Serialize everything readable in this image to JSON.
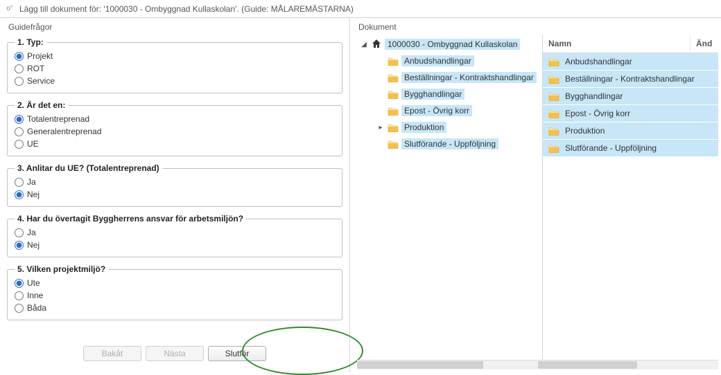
{
  "window": {
    "title": "Lägg till dokument för: '1000030 - Ombyggnad Kullaskolan'.  (Guide: MÅLAREMÄSTARNA)"
  },
  "left": {
    "heading": "Guidefrågor",
    "questions": [
      {
        "legend": "1. Typ:",
        "name": "q1",
        "selected": 0,
        "options": [
          "Projekt",
          "ROT",
          "Service"
        ]
      },
      {
        "legend": "2. Är det en:",
        "name": "q2",
        "selected": 0,
        "options": [
          "Totalentreprenad",
          "Generalentreprenad",
          "UE"
        ]
      },
      {
        "legend": "3. Anlitar du UE? (Totalentreprenad)",
        "name": "q3",
        "selected": 1,
        "options": [
          "Ja",
          "Nej"
        ]
      },
      {
        "legend": "4. Har du övertagit Byggherrens ansvar för arbetsmiljön?",
        "name": "q4",
        "selected": 1,
        "options": [
          "Ja",
          "Nej"
        ]
      },
      {
        "legend": "5. Vilken projektmiljö?",
        "name": "q5",
        "selected": 0,
        "options": [
          "Ute",
          "Inne",
          "Båda"
        ]
      }
    ],
    "buttons": {
      "back": "Bakåt",
      "next": "Nästa",
      "finish": "Slutför"
    }
  },
  "right": {
    "heading": "Dokument",
    "tree": {
      "root": "1000030 - Ombyggnad Kullaskolan",
      "children": [
        {
          "label": "Anbudshandlingar",
          "expandable": false
        },
        {
          "label": "Beställningar - Kontraktshandlingar",
          "expandable": false
        },
        {
          "label": "Bygghandlingar",
          "expandable": false
        },
        {
          "label": "Epost - Övrig korr",
          "expandable": false
        },
        {
          "label": "Produktion",
          "expandable": true
        },
        {
          "label": "Slutförande - Uppföljning",
          "expandable": false
        }
      ]
    },
    "list": {
      "headers": {
        "name": "Namn",
        "and": "Änd"
      },
      "rows": [
        "Anbudshandlingar",
        "Beställningar - Kontraktshandlingar",
        "Bygghandlingar",
        "Epost - Övrig korr",
        "Produktion",
        "Slutförande - Uppföljning"
      ]
    }
  }
}
